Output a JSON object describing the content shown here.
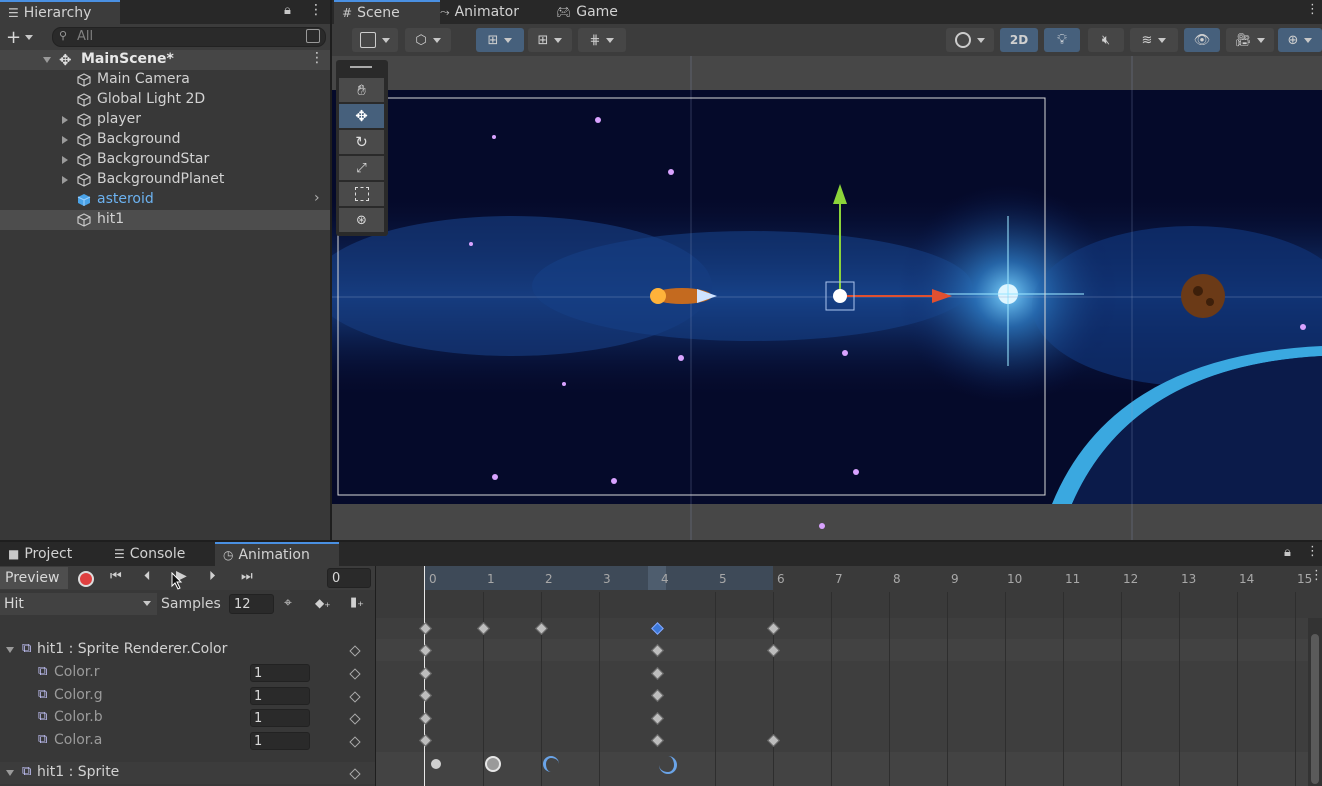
{
  "hierarchy": {
    "tab_label": "Hierarchy",
    "search_placeholder": "All",
    "scene_name": "MainScene*",
    "items": [
      {
        "label": "Main Camera"
      },
      {
        "label": "Global Light 2D"
      },
      {
        "label": "player"
      },
      {
        "label": "Background"
      },
      {
        "label": "BackgroundStar"
      },
      {
        "label": "BackgroundPlanet"
      },
      {
        "label": "asteroid"
      },
      {
        "label": "hit1"
      }
    ]
  },
  "scene_tabs": {
    "scene": "Scene",
    "animator": "Animator",
    "game": "Game"
  },
  "scene_toolbar": {
    "mode_2d": "2D"
  },
  "bottom_tabs": {
    "project": "Project",
    "console": "Console",
    "animation": "Animation"
  },
  "animation": {
    "preview_label": "Preview",
    "frame_value": "0",
    "clip_name": "Hit",
    "samples_label": "Samples",
    "samples_value": "12",
    "timeline_ticks": [
      "0",
      "1",
      "2",
      "3",
      "4",
      "5",
      "6",
      "7",
      "8",
      "9",
      "10",
      "11",
      "12",
      "13",
      "14",
      "15"
    ],
    "properties": [
      {
        "label": "hit1 : Sprite Renderer.Color",
        "value": ""
      },
      {
        "label": "Color.r",
        "value": "1"
      },
      {
        "label": "Color.g",
        "value": "1"
      },
      {
        "label": "Color.b",
        "value": "1"
      },
      {
        "label": "Color.a",
        "value": "1"
      },
      {
        "label": "hit1 : Sprite",
        "value": ""
      }
    ]
  },
  "colors": {
    "accent": "#4a90e2",
    "selected_key": "#3c78d8",
    "panel": "#383838",
    "scene_bg": "#050a2a"
  }
}
